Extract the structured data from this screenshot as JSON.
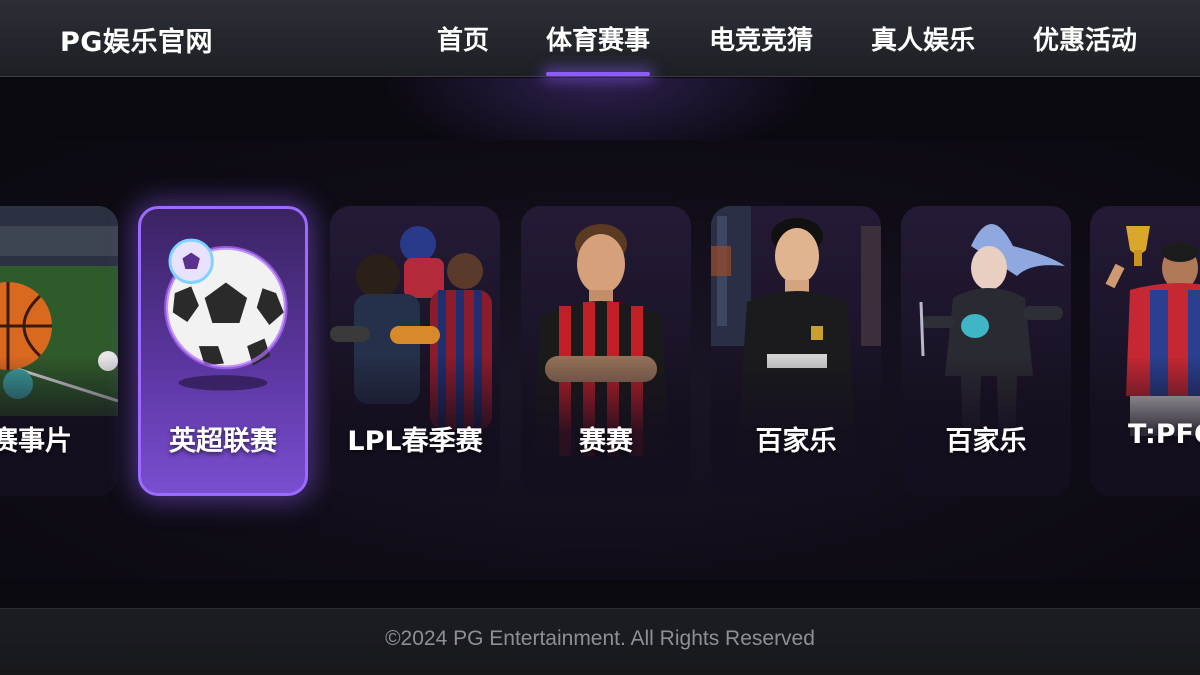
{
  "header": {
    "logo": "PG娱乐官网",
    "nav": [
      {
        "label": "首页",
        "active": false
      },
      {
        "label": "体育赛事",
        "active": true
      },
      {
        "label": "电竞竞猜",
        "active": false
      },
      {
        "label": "真人娱乐",
        "active": false
      },
      {
        "label": "优惠活动",
        "active": false
      }
    ]
  },
  "cards": [
    {
      "label": "赛事片",
      "icon": "basketball-stadium-icon"
    },
    {
      "label": "英超联赛",
      "icon": "soccer-ball-icon",
      "active": true
    },
    {
      "label": "LPL春季赛",
      "icon": "esports-players-icon"
    },
    {
      "label": "赛赛",
      "icon": "soccer-player-icon"
    },
    {
      "label": "百家乐",
      "icon": "soccer-player-icon"
    },
    {
      "label": "百家乐",
      "icon": "fantasy-warrior-icon"
    },
    {
      "label": "T:PFC",
      "icon": "trophy-player-icon"
    }
  ],
  "footer": {
    "copyright": "©2024 PG Entertainment. All Rights Reserved"
  },
  "colors": {
    "accent": "#8b5cf6",
    "header_bg": "#25272d",
    "page_bg": "#0b0910",
    "card_bg": "#1d1529",
    "footer_text": "#8d8f96"
  }
}
